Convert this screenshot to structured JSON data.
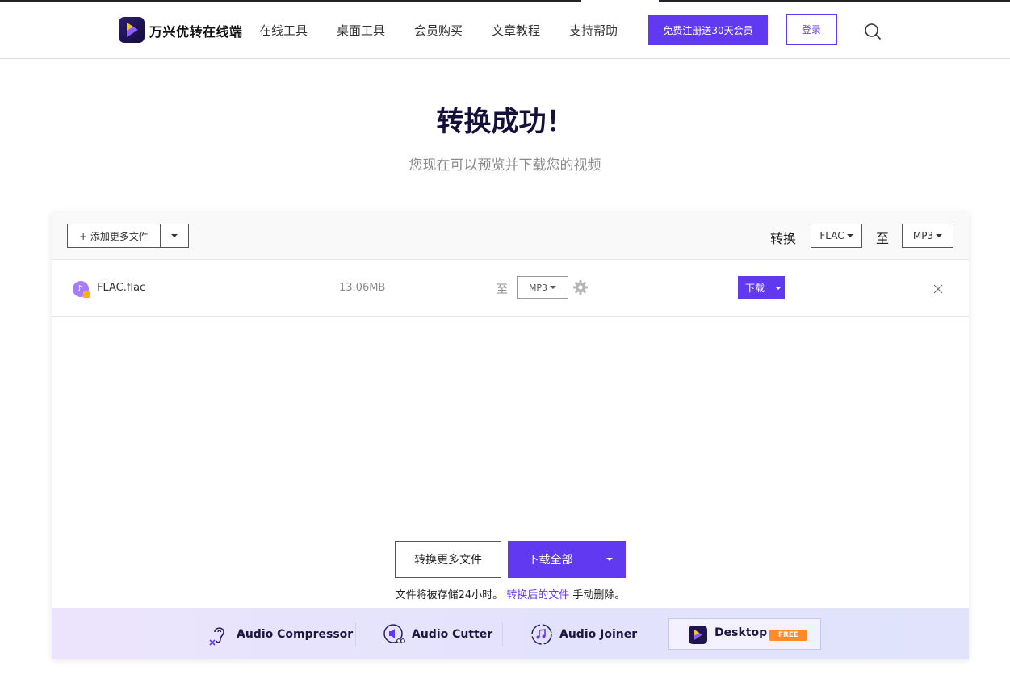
{
  "header": {
    "brand": "万兴优转在线端",
    "nav": [
      "在线工具",
      "桌面工具",
      "会员购买",
      "文章教程",
      "支持帮助"
    ],
    "register_label": "免费注册送30天会员",
    "login_label": "登录"
  },
  "main": {
    "title": "转换成功！",
    "subtitle": "您现在可以预览并下载您的视频"
  },
  "toolbar": {
    "add_label": "+ 添加更多文件",
    "convert_label": "转换",
    "from_format": "FLAC",
    "to_label": "至",
    "to_format": "MP3"
  },
  "files": [
    {
      "name": "FLAC.flac",
      "size": "13.06MB",
      "to_label": "至",
      "format": "MP3",
      "download_label": "下载"
    }
  ],
  "actions": {
    "convert_more": "转换更多文件",
    "download_all": "下载全部",
    "note_prefix": "文件将被存储24小时。",
    "note_link": "转换后的文件",
    "note_suffix": " 手动删除。"
  },
  "tools": {
    "compressor": "Audio Compressor",
    "cutter": "Audio Cutter",
    "joiner": "Audio Joiner",
    "desktop": "Desktop",
    "free_badge": "FREE"
  },
  "colors": {
    "accent": "#6139f0",
    "title": "#14103b",
    "free_badge": "#ff8a2a"
  }
}
